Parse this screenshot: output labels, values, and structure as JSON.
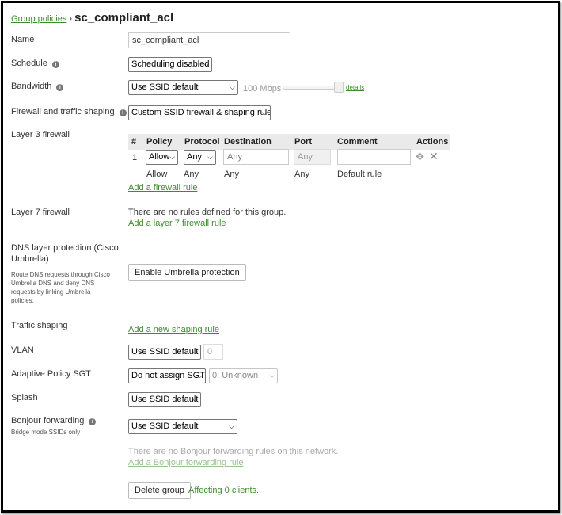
{
  "breadcrumb": {
    "parent": "Group policies",
    "separator": "›",
    "title": "sc_compliant_acl"
  },
  "name": {
    "label": "Name",
    "value": "sc_compliant_acl"
  },
  "schedule": {
    "label": "Schedule",
    "selected": "Scheduling disabled"
  },
  "bandwidth": {
    "label": "Bandwidth",
    "selected": "Use SSID default",
    "speed": "100 Mbps",
    "details_link": "details"
  },
  "firewall_shaping": {
    "label": "Firewall and traffic shaping",
    "selected": "Custom SSID firewall & shaping rules"
  },
  "layer3": {
    "label": "Layer 3 firewall",
    "headers": [
      "#",
      "Policy",
      "Protocol",
      "Destination",
      "Port",
      "Comment",
      "Actions"
    ],
    "rule": {
      "num": "1",
      "policy": "Allow",
      "protocol": "Any",
      "destination_placeholder": "Any",
      "port_placeholder": "Any",
      "comment": ""
    },
    "default_rule": {
      "policy": "Allow",
      "protocol": "Any",
      "destination": "Any",
      "port": "Any",
      "comment": "Default rule"
    },
    "add_link": "Add a firewall rule"
  },
  "layer7": {
    "label": "Layer 7 firewall",
    "message": "There are no rules defined for this group.",
    "add_link": "Add a layer 7 firewall rule"
  },
  "dns": {
    "label_line1": "DNS layer protection (Cisco",
    "label_line2": "Umbrella)",
    "desc_lines": [
      "Route DNS requests through Cisco",
      "Umbrella DNS and deny DNS",
      "requests by linking Umbrella",
      "policies."
    ],
    "button": "Enable Umbrella protection"
  },
  "traffic_shaping": {
    "label": "Traffic shaping",
    "add_link": "Add a new shaping rule"
  },
  "vlan": {
    "label": "VLAN",
    "selected": "Use SSID default",
    "value_placeholder": "0"
  },
  "adaptive_sgt": {
    "label": "Adaptive Policy SGT",
    "selected": "Do not assign SGT",
    "sgt_selected": "0: Unknown"
  },
  "splash": {
    "label": "Splash",
    "selected": "Use SSID default"
  },
  "bonjour": {
    "label": "Bonjour forwarding",
    "sublabel": "Bridge mode SSIDs only",
    "selected": "Use SSID default",
    "message": "There are no Bonjour forwarding rules on this network.",
    "add_link": "Add a Bonjour forwarding rule"
  },
  "footer": {
    "delete_button": "Delete group",
    "affecting_link": "Affecting 0 clients."
  },
  "icons": {
    "info": "info-icon",
    "chevron": "chevron-down-icon",
    "move": "move-icon",
    "delete": "close-icon"
  },
  "colors": {
    "link": "#3e8b2f",
    "link_muted": "#9bbf93",
    "table_header": "#eaeaea"
  }
}
